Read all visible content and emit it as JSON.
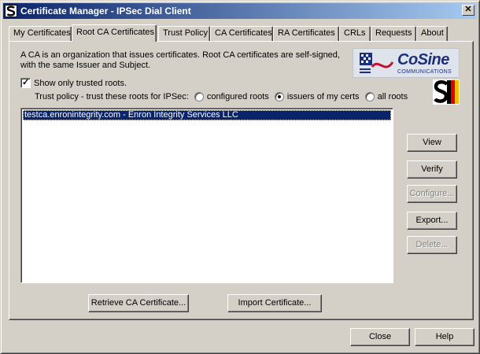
{
  "window": {
    "title": "Certificate Manager - IPSec Dial Client",
    "close_glyph": "✕"
  },
  "tabs": [
    {
      "label": "My Certificates",
      "active": false
    },
    {
      "label": "Root CA Certificates",
      "active": true
    },
    {
      "label": "Trust Policy",
      "active": false
    },
    {
      "label": "CA Certificates",
      "active": false
    },
    {
      "label": "RA Certificates",
      "active": false
    },
    {
      "label": "CRLs",
      "active": false
    },
    {
      "label": "Requests",
      "active": false
    },
    {
      "label": "About",
      "active": false
    }
  ],
  "panel": {
    "description_line1": "A CA is an organization that issues certificates.  Root CA certificates are self-signed,",
    "description_line2": "with the same Issuer and Subject.",
    "logo_text": "CoSine",
    "logo_sub": "COMMUNICATIONS",
    "show_trusted": {
      "label": "Show only trusted roots.",
      "checked": true
    },
    "trust_policy": {
      "label": "Trust policy - trust these roots for IPSec:",
      "options": [
        {
          "label": "configured roots",
          "selected": false
        },
        {
          "label": "issuers of my certs",
          "selected": true
        },
        {
          "label": "all roots",
          "selected": false
        }
      ]
    },
    "certificates": [
      {
        "text": "testca.enronintegrity.com - Enron Integrity Services LLC",
        "selected": true
      }
    ],
    "side_buttons": {
      "view": "View",
      "verify": "Verify",
      "configure": "Configure...",
      "export": "Export...",
      "delete": "Delete..."
    },
    "bottom_buttons": {
      "retrieve": "Retrieve CA Certificate...",
      "import": "Import Certificate..."
    }
  },
  "footer": {
    "close": "Close",
    "help": "Help"
  },
  "colors": {
    "selection": "#0a246a",
    "face": "#d4d0c8",
    "logo_brand": "#1b2f7a"
  }
}
